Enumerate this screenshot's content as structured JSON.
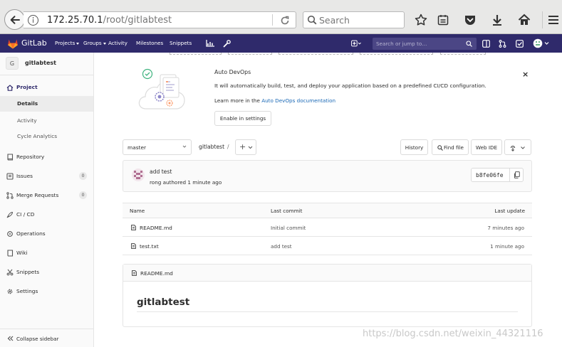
{
  "browser": {
    "url_host": "172.25.70.1",
    "url_path": "/root/gitlabtest",
    "search_placeholder": "Search"
  },
  "navbar": {
    "brand": "GitLab",
    "links": [
      "Projects",
      "Groups",
      "Activity",
      "Milestones",
      "Snippets"
    ],
    "search_placeholder": "Search or jump to…",
    "colors": {
      "background": "#2f2a6b",
      "search": "#4b4685",
      "logo": "#e24329"
    }
  },
  "sidebar": {
    "project_initial": "G",
    "project_name": "gitlabtest",
    "project_label": "Project",
    "project_subitems": [
      "Details",
      "Activity",
      "Cycle Analytics"
    ],
    "items": [
      {
        "label": "Repository"
      },
      {
        "label": "Issues",
        "count": "0"
      },
      {
        "label": "Merge Requests",
        "count": "0"
      },
      {
        "label": "CI / CD"
      },
      {
        "label": "Operations"
      },
      {
        "label": "Wiki"
      },
      {
        "label": "Snippets"
      },
      {
        "label": "Settings"
      }
    ],
    "collapse_label": "Collapse sidebar"
  },
  "devops": {
    "title": "Auto DevOps",
    "description": "It will automatically build, test, and deploy your application based on a predefined CI/CD configuration.",
    "learn_prefix": "Learn more in the ",
    "learn_link": "Auto DevOps documentation",
    "button": "Enable in settings",
    "close": "×"
  },
  "toolbar": {
    "branch": "master",
    "breadcrumb": "gitlabtest",
    "slash": "/",
    "plus": "+",
    "history": "History",
    "find_file": "Find file",
    "web_ide": "Web IDE"
  },
  "commit": {
    "title": "add test",
    "meta": "rong authored 1 minute ago",
    "sha": "b8fe06fe"
  },
  "tree": {
    "headers": {
      "name": "Name",
      "last_commit": "Last commit",
      "last_update": "Last update"
    },
    "rows": [
      {
        "name": "README.md",
        "commit": "Initial commit",
        "updated": "7 minutes ago"
      },
      {
        "name": "test.txt",
        "commit": "add test",
        "updated": "1 minute ago"
      }
    ]
  },
  "readme": {
    "file": "README.md",
    "heading": "gitlabtest"
  },
  "watermark": "https://blog.csdn.net/weixin_44321116"
}
